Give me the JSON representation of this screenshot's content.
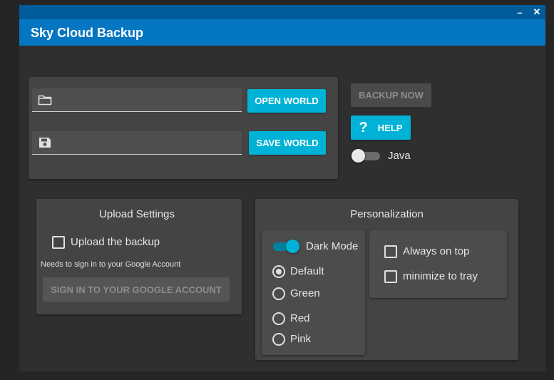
{
  "window": {
    "title": "Sky Cloud Backup",
    "minimize_glyph": "–",
    "close_glyph": "✕"
  },
  "world": {
    "open_field": {
      "value": "",
      "icon": "folder-icon"
    },
    "open_button": "OPEN WORLD",
    "save_field": {
      "value": "",
      "icon": "save-icon"
    },
    "save_button": "SAVE WORLD"
  },
  "actions": {
    "backup_now": "BACKUP NOW",
    "help": "HELP",
    "help_glyph": "?",
    "java_label": "Java",
    "java_on": false
  },
  "upload": {
    "heading": "Upload Settings",
    "upload_backup_label": "Upload the backup",
    "upload_backup_checked": false,
    "note": "Needs to sign in to your Google Account",
    "sign_in_button": "SIGN IN TO YOUR GOOGLE ACCOUNT"
  },
  "personalization": {
    "heading": "Personalization",
    "dark_mode_label": "Dark Mode",
    "dark_mode_on": true,
    "themes": [
      {
        "label": "Default",
        "selected": true
      },
      {
        "label": "Green",
        "selected": false
      },
      {
        "label": "Red",
        "selected": false
      },
      {
        "label": "Pink",
        "selected": false
      }
    ],
    "always_on_top_label": "Always on top",
    "minimize_to_tray_label": "minimize to tray"
  },
  "colors": {
    "accent": "#00b3d6",
    "title_bar": "#0576c2",
    "title_strip": "#005c9b"
  }
}
